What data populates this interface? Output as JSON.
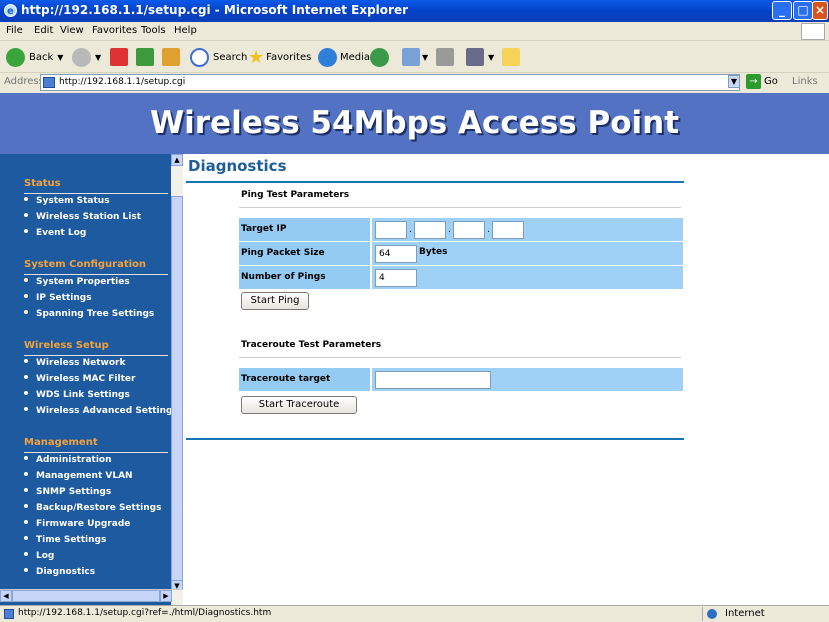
{
  "window": {
    "title": "http://192.168.1.1/setup.cgi - Microsoft Internet Explorer"
  },
  "menu": [
    "File",
    "Edit",
    "View",
    "Favorites",
    "Tools",
    "Help"
  ],
  "toolbar": {
    "back": "Back",
    "search": "Search",
    "favorites": "Favorites",
    "media": "Media"
  },
  "address": {
    "label": "Address",
    "url": "http://192.168.1.1/setup.cgi",
    "go": "Go",
    "links": "Links"
  },
  "banner": "Wireless 54Mbps Access Point",
  "sidebar": {
    "sections": [
      {
        "title": "Status",
        "items": [
          "System Status",
          "Wireless Station List",
          "Event Log"
        ]
      },
      {
        "title": "System Configuration",
        "items": [
          "System Properties",
          "IP Settings",
          "Spanning Tree Settings"
        ]
      },
      {
        "title": "Wireless Setup",
        "items": [
          "Wireless Network",
          "Wireless MAC Filter",
          "WDS Link Settings",
          "Wireless Advanced Settings"
        ]
      },
      {
        "title": "Management",
        "items": [
          "Administration",
          "Management VLAN",
          "SNMP Settings",
          "Backup/Restore Settings",
          "Firmware Upgrade",
          "Time Settings",
          "Log",
          "Diagnostics"
        ]
      }
    ]
  },
  "page": {
    "title": "Diagnostics",
    "ping": {
      "heading": "Ping Test Parameters",
      "target_ip_label": "Target IP",
      "target_ip": [
        "",
        "",
        "",
        ""
      ],
      "packet_size_label": "Ping Packet Size",
      "packet_size": "64",
      "packet_size_unit": "Bytes",
      "num_pings_label": "Number of Pings",
      "num_pings": "4",
      "button": "Start Ping"
    },
    "traceroute": {
      "heading": "Traceroute Test Parameters",
      "target_label": "Traceroute target",
      "target": "",
      "button": "Start Traceroute"
    }
  },
  "status": {
    "text": "http://192.168.1.1/setup.cgi?ref=./html/Diagnostics.htm",
    "zone": "Internet"
  }
}
